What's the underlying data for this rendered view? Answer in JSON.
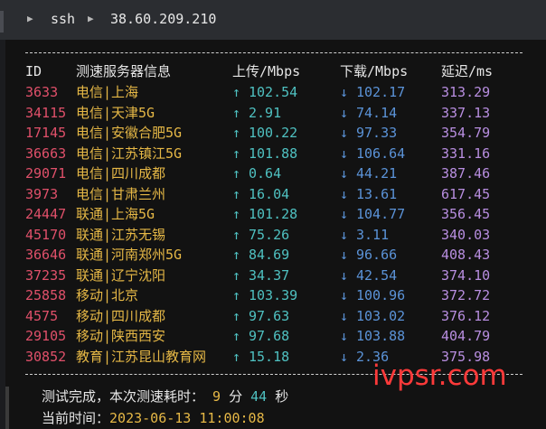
{
  "titlebar": {
    "crumbs": [
      "ssh",
      "38.60.209.210"
    ]
  },
  "table": {
    "headers": {
      "id": "ID",
      "server": "测速服务器信息",
      "upload": "上传/Mbps",
      "download": "下载/Mbps",
      "latency": "延迟/ms"
    },
    "rows": [
      {
        "id": "3633",
        "server": "电信|上海",
        "upload": "102.54",
        "download": "102.17",
        "latency": "313.29"
      },
      {
        "id": "34115",
        "server": "电信|天津5G",
        "upload": "2.91",
        "download": "74.14",
        "latency": "337.13"
      },
      {
        "id": "17145",
        "server": "电信|安徽合肥5G",
        "upload": "100.22",
        "download": "97.33",
        "latency": "354.79"
      },
      {
        "id": "36663",
        "server": "电信|江苏镇江5G",
        "upload": "101.88",
        "download": "106.64",
        "latency": "331.16"
      },
      {
        "id": "29071",
        "server": "电信|四川成都",
        "upload": "0.64",
        "download": "44.21",
        "latency": "387.46"
      },
      {
        "id": "3973",
        "server": "电信|甘肃兰州",
        "upload": "16.04",
        "download": "13.61",
        "latency": "617.45"
      },
      {
        "id": "24447",
        "server": "联通|上海5G",
        "upload": "101.28",
        "download": "104.77",
        "latency": "356.45"
      },
      {
        "id": "45170",
        "server": "联通|江苏无锡",
        "upload": "75.26",
        "download": "3.11",
        "latency": "340.03"
      },
      {
        "id": "36646",
        "server": "联通|河南郑州5G",
        "upload": "84.69",
        "download": "96.66",
        "latency": "408.43"
      },
      {
        "id": "37235",
        "server": "联通|辽宁沈阳",
        "upload": "34.37",
        "download": "42.54",
        "latency": "374.10"
      },
      {
        "id": "25858",
        "server": "移动|北京",
        "upload": "103.39",
        "download": "100.96",
        "latency": "372.72"
      },
      {
        "id": "4575",
        "server": "移动|四川成都",
        "upload": "97.63",
        "download": "103.02",
        "latency": "376.12"
      },
      {
        "id": "29105",
        "server": "移动|陕西西安",
        "upload": "97.68",
        "download": "103.88",
        "latency": "404.79"
      },
      {
        "id": "30852",
        "server": "教育|江苏昆山教育网",
        "upload": "15.18",
        "download": "2.36",
        "latency": "375.98"
      }
    ]
  },
  "footer": {
    "done_label": "测试完成，本次测速耗时：",
    "minutes": "9",
    "min_unit": "分",
    "seconds": "44",
    "sec_unit": "秒",
    "time_label": "当前时间：",
    "time_value": "2023-06-13 11:00:08"
  },
  "watermark": "ivpsr.com"
}
